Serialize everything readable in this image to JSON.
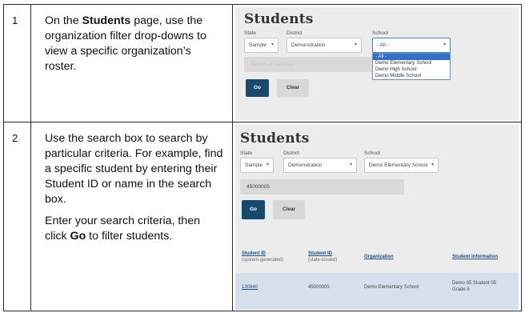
{
  "steps": [
    {
      "number": "1",
      "paragraphs": [
        {
          "pre": "On the ",
          "bold": "Students",
          "post": " page, use the organization filter drop-downs to view a specific organization’s roster."
        }
      ],
      "panel": {
        "title": "Students",
        "state_label": "State",
        "state_value": "Sample",
        "district_label": "District",
        "district_value": "Demonstration",
        "school_label": "School",
        "school_value": "- All -",
        "search_placeholder": "Search all students",
        "go_label": "Go",
        "clear_label": "Clear",
        "school_options": [
          "- All -",
          "Demo Elementary School",
          "Demo High School",
          "Demo Middle School"
        ],
        "selected_option": "- All -"
      }
    },
    {
      "number": "2",
      "paragraphs": [
        {
          "pre": "Use the search box to search by particular criteria. For example, find a specific student by entering their Student ID or name in the search box.",
          "bold": "",
          "post": ""
        },
        {
          "pre": "Enter your search criteria, then click ",
          "bold": "Go",
          "post": " to filter students."
        }
      ],
      "panel": {
        "title": "Students",
        "state_label": "State",
        "state_value": "Sample",
        "district_label": "District",
        "district_value": "Demonstration",
        "school_label": "School",
        "school_value": "Demo Elementary School",
        "search_value": "45000005",
        "go_label": "Go",
        "clear_label": "Clear",
        "columns": [
          {
            "title": "Student ID",
            "sub": "(system-generated)"
          },
          {
            "title": "Student ID",
            "sub": "(state-issued)"
          },
          {
            "title": "Organization",
            "sub": ""
          },
          {
            "title": "Student Information",
            "sub": ""
          }
        ],
        "row": {
          "system_id": "130840",
          "state_id": "45000005",
          "organization": "Demo Elementary School",
          "info_name": "Demo 05 Student 05",
          "info_grade": "Grade 5"
        }
      }
    }
  ]
}
